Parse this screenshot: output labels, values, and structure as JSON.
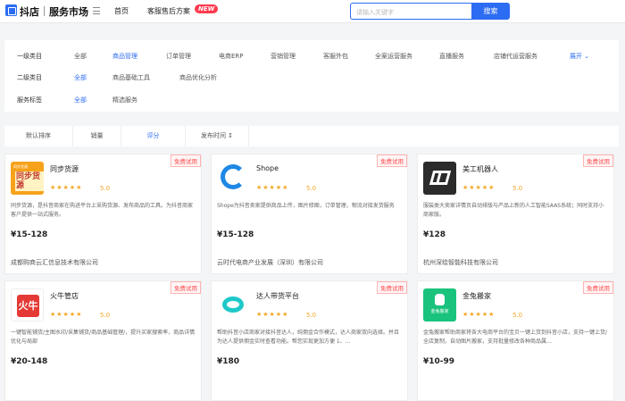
{
  "header": {
    "logo_text": "抖店",
    "market_text": "服务市场",
    "nav_home": "首页",
    "nav_service": "客服售后方案",
    "new_badge": "NEW",
    "search_placeholder": "请输入关键字",
    "search_button": "搜索"
  },
  "filters": {
    "level1": {
      "label": "一级类目",
      "options": [
        "全部",
        "商品管理",
        "订单管理",
        "电商ERP",
        "营销管理",
        "客服外包",
        "全案运营服务",
        "直播服务",
        "店铺代运营服务"
      ],
      "active_index": 1
    },
    "level2": {
      "label": "二级类目",
      "options": [
        "全部",
        "商品基础工具",
        "商品优化分析"
      ],
      "active_index": 0
    },
    "tags": {
      "label": "服务标签",
      "options": [
        "全部",
        "精选服务"
      ],
      "active_index": 0
    },
    "expand_label": "展开 ⌄"
  },
  "sort": {
    "items": [
      "默认排序",
      "销量",
      "评分",
      "发布时间 ↕"
    ],
    "active_index": 2
  },
  "cards": [
    {
      "title": "同步货源",
      "rating": "5.0",
      "trial": "免费试用",
      "desc": "同步货源，是抖音商家在购进平台上采购货源、发布商品的工具。为抖音商家客户提供一站式服务。",
      "price": "¥15-128",
      "company": "成都购商云汇信息技术有限公司",
      "thumb_top": "同步货源",
      "thumb_main": "同步货源"
    },
    {
      "title": "Shope",
      "rating": "5.0",
      "trial": "免费试用",
      "desc": "Shope为抖音卖家提供商品上传，图片修图，订单管理，物流对接发货服务",
      "price": "¥15-128",
      "company": "云时代电商产业发展（深圳）有限公司"
    },
    {
      "title": "美工机器人",
      "rating": "5.0",
      "trial": "免费试用",
      "desc": "服装类大卖家详情页自动排版与产品上新的人工智能SAAS系统；同时支持小商家版。",
      "price": "¥128",
      "company": "杭州深绘智能科技有限公司"
    },
    {
      "title": "火牛管店",
      "rating": "5.0",
      "trial": "免费试用",
      "desc": "一键智能铺货/主图水印/采集铺货/商品基础管理/，提升买家搜索率，商品详情优化与局部",
      "price": "¥20-148",
      "thumb_main": "火牛"
    },
    {
      "title": "达人带货平台",
      "rating": "5.0",
      "trial": "免费试用",
      "desc": "帮助抖音小店商家对接抖音达人，纯佣金合作模式，达人商家双向选择。并且为达人提供佣金实时查看功能。帮您实现更加方便 1、...",
      "price": "¥180"
    },
    {
      "title": "金兔搬家",
      "rating": "5.0",
      "trial": "免费试用",
      "desc": "金兔搬家帮助商家将各大电商平台的宝贝一键上货到抖音小店，支持一键上货/全店复制，自动图片搬家，支持批量修改各种商品属...",
      "price": "¥10-99",
      "thumb_main": "金兔搬家"
    }
  ]
}
